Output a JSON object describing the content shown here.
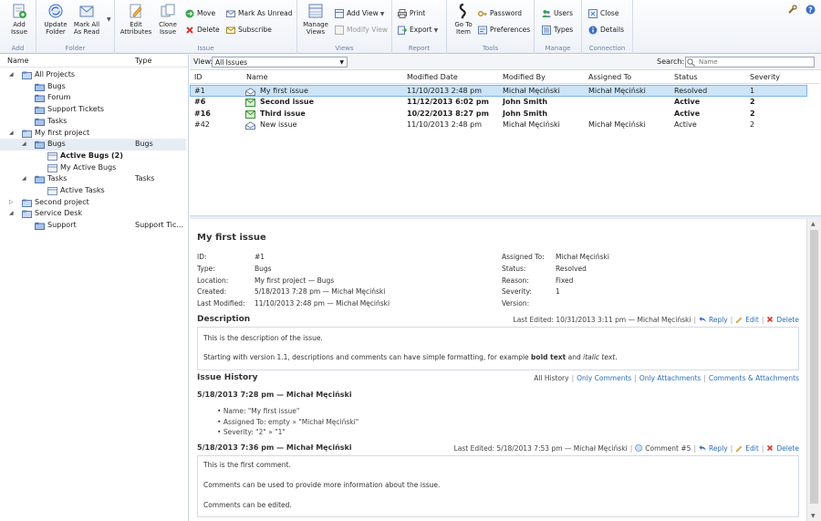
{
  "ribbon": {
    "groups": {
      "add": "Add",
      "folder": "Folder",
      "issue": "Issue",
      "views": "Views",
      "report": "Report",
      "tools": "Tools",
      "manage": "Manage",
      "connection": "Connection"
    },
    "add_issue": "Add\nIssue",
    "update_folder": "Update\nFolder",
    "mark_all_read": "Mark All\nAs Read",
    "edit_attributes": "Edit\nAttributes",
    "clone_issue": "Clone\nIssue",
    "move": "Move",
    "delete": "Delete",
    "mark_unread": "Mark As Unread",
    "subscribe": "Subscribe",
    "manage_views": "Manage\nViews",
    "add_view": "Add View",
    "modify_view": "Modify View",
    "print": "Print",
    "export": "Export",
    "go_to_item": "Go To\nItem",
    "password": "Password",
    "preferences": "Preferences",
    "users": "Users",
    "types": "Types",
    "close": "Close",
    "details": "Details"
  },
  "tree": {
    "col_name": "Name",
    "col_type": "Type",
    "items": [
      {
        "label": "All Projects",
        "type": ""
      },
      {
        "label": "Bugs",
        "type": ""
      },
      {
        "label": "Forum",
        "type": ""
      },
      {
        "label": "Support Tickets",
        "type": ""
      },
      {
        "label": "Tasks",
        "type": ""
      },
      {
        "label": "My first project",
        "type": ""
      },
      {
        "label": "Bugs",
        "type": "Bugs"
      },
      {
        "label": "Active Bugs (2)",
        "type": ""
      },
      {
        "label": "My Active Bugs",
        "type": ""
      },
      {
        "label": "Tasks",
        "type": "Tasks"
      },
      {
        "label": "Active Tasks",
        "type": ""
      },
      {
        "label": "Second project",
        "type": ""
      },
      {
        "label": "Service Desk",
        "type": ""
      },
      {
        "label": "Support",
        "type": "Support Tic..."
      }
    ]
  },
  "viewbar": {
    "view_label": "View:",
    "view_value": "All Issues",
    "search_label": "Search:",
    "search_placeholder": "Name"
  },
  "grid": {
    "columns": [
      "ID",
      "Name",
      "Modified Date",
      "Modified By",
      "Assigned To",
      "Status",
      "Severity"
    ],
    "rows": [
      {
        "id": "#1",
        "name": "My first issue",
        "modified": "11/10/2013 2:48 pm",
        "by": "Michał Męciński",
        "assigned": "Michał Męciński",
        "status": "Resolved",
        "severity": "1"
      },
      {
        "id": "#6",
        "name": "Second issue",
        "modified": "11/12/2013 6:02 pm",
        "by": "John Smith",
        "assigned": "",
        "status": "Active",
        "severity": "2"
      },
      {
        "id": "#16",
        "name": "Third issue",
        "modified": "10/22/2013 8:27 pm",
        "by": "John Smith",
        "assigned": "",
        "status": "Active",
        "severity": "2"
      },
      {
        "id": "#42",
        "name": "New issue",
        "modified": "11/10/2013 2:48 pm",
        "by": "Michał Męciński",
        "assigned": "Michał Męciński",
        "status": "Active",
        "severity": "2"
      }
    ]
  },
  "details": {
    "title": "My first issue",
    "fields_left": [
      {
        "label": "ID:",
        "value": "#1"
      },
      {
        "label": "Type:",
        "value": "Bugs"
      },
      {
        "label": "Location:",
        "value": "My first project — Bugs"
      },
      {
        "label": "Created:",
        "value": "5/18/2013 7:28 pm — Michał Męciński"
      },
      {
        "label": "Last Modified:",
        "value": "11/10/2013 2:48 pm — Michał Męciński"
      }
    ],
    "fields_right": [
      {
        "label": "Assigned To:",
        "value": "Michał Męciński"
      },
      {
        "label": "Status:",
        "value": "Resolved"
      },
      {
        "label": "Reason:",
        "value": "Fixed"
      },
      {
        "label": "Severity:",
        "value": "1"
      },
      {
        "label": "Version:",
        "value": ""
      }
    ],
    "description_heading": "Description",
    "description_edited": "Last Edited: 10/31/2013 3:11 pm — Michał Męciński",
    "reply": "Reply",
    "edit": "Edit",
    "delete": "Delete",
    "description_lines": [
      "This is the description of the issue.",
      "Starting with version 1.1, descriptions and comments can have simple formatting, for example",
      "bold text",
      "and",
      "italic text",
      "."
    ],
    "history_heading": "Issue History",
    "history_filters": [
      "All History",
      "Only Comments",
      "Only Attachments",
      "Comments & Attachments"
    ],
    "entries": [
      {
        "header": "5/18/2013 7:28 pm — Michał Męciński",
        "bullets": [
          "Name: \"My first issue\"",
          "Assigned To: empty » \"Michał Męciński\"",
          "Severity: \"2\" » \"1\""
        ]
      },
      {
        "header": "5/18/2013 7:36 pm — Michał Męciński",
        "edited": "Last Edited: 5/18/2013 7:53 pm — Michał Męciński",
        "comment_no": "Comment #5",
        "lines": [
          "This is the first comment.",
          "Comments can be used to provide more information about the issue.",
          "Comments can be edited."
        ]
      }
    ]
  }
}
